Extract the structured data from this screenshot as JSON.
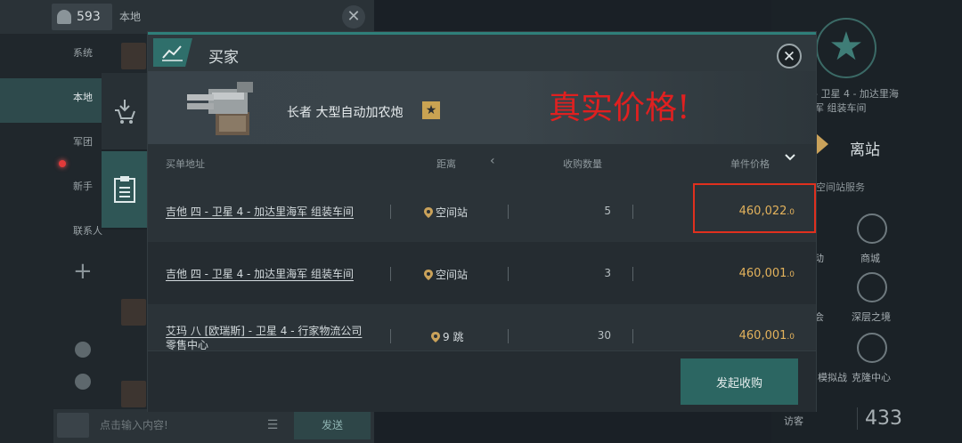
{
  "chat": {
    "count": "593",
    "tab_title": "本地",
    "channels": [
      "系统",
      "本地",
      "军团",
      "新手",
      "联系人"
    ],
    "input_placeholder": "点击输入内容!",
    "send_label": "发送"
  },
  "station": {
    "location_line1": "- 卫星 4 - 加达里海",
    "location_line2": "军 组装车间",
    "title": "离站",
    "services_label": "空间站服务",
    "services": [
      "商城",
      "深层之境",
      "克隆中心"
    ],
    "partial_labels": [
      "动",
      "会",
      "模拟战"
    ],
    "visitor_label": "访客",
    "visitor_count": "433"
  },
  "modal": {
    "title": "买家",
    "close_icon": "close-icon",
    "item": {
      "name": "长者 大型自动加农炮",
      "star_icon": "star-icon"
    },
    "annotation": "真实价格!",
    "columns": {
      "address": "买单地址",
      "distance": "距离",
      "quantity": "收购数量",
      "price": "单件价格"
    },
    "rows": [
      {
        "address": "吉他 四 - 卫星 4 - 加达里海军 组装车间",
        "distance": "空间站",
        "quantity": "5",
        "price_int": "460,022",
        "price_dec": ".0"
      },
      {
        "address": "吉他 四 - 卫星 4 - 加达里海军 组装车间",
        "distance": "空间站",
        "quantity": "3",
        "price_int": "460,001",
        "price_dec": ".0"
      },
      {
        "address": "艾玛 八 [欧瑞斯] - 卫星 4 - 行家物流公司 零售中心",
        "distance": "9 跳",
        "quantity": "30",
        "price_int": "460,001",
        "price_dec": ".0"
      }
    ],
    "buy_button": "发起收购"
  },
  "colors": {
    "accent": "#2f7f7a",
    "price": "#e3b25c",
    "annotation": "#e02020",
    "highlight": "#e0301e"
  }
}
